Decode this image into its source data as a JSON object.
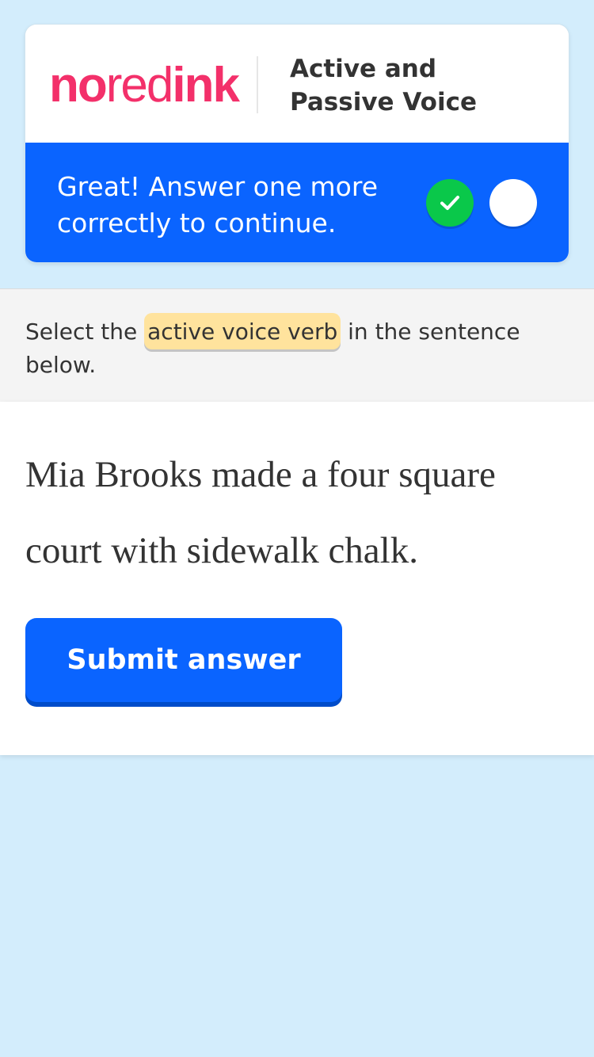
{
  "header": {
    "logo_parts": [
      "no",
      "red",
      "ink"
    ],
    "lesson_title": "Active and Passive Voice"
  },
  "progress": {
    "message": "Great! Answer one more correctly to continue.",
    "answered_correctly": 1,
    "required": 2,
    "colors": {
      "bar": "#0a64ff",
      "complete": "#0ac84a",
      "pending": "#ffffff"
    }
  },
  "instruction": {
    "prefix": "Select the",
    "term": "active voice verb",
    "suffix": "in the sentence below."
  },
  "question": {
    "sentence": "Mia Brooks made a four square court with sidewalk chalk."
  },
  "actions": {
    "submit_label": "Submit answer"
  },
  "colors": {
    "background": "#d3edfc",
    "brand_pink": "#f3306a",
    "highlight": "#ffe39d",
    "primary": "#0a64ff"
  }
}
